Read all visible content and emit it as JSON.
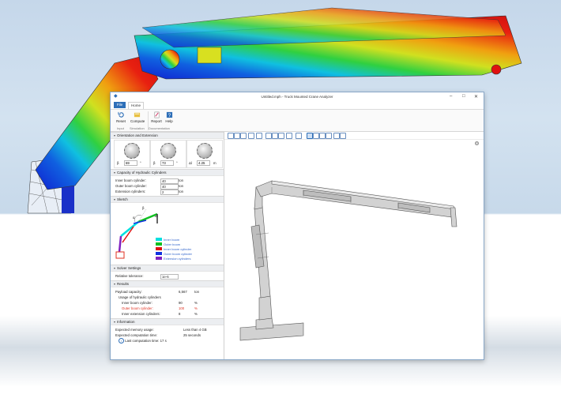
{
  "window": {
    "title": "Untitled.mph - Truck Mounted Crane Analyzer",
    "controls": [
      "–",
      "□",
      "✕"
    ]
  },
  "tabs": {
    "file": "File",
    "home": "Home"
  },
  "ribbon": {
    "reset": "Reset",
    "compute": "Compute",
    "report": "Report",
    "help": "Help",
    "groups": [
      "Input",
      "Simulation",
      "Documentation"
    ]
  },
  "orientation": {
    "header": "Orientation and Extension",
    "knobs": [
      {
        "sym": "β",
        "value": "69",
        "unit": "°"
      },
      {
        "sym": "β",
        "value": "73",
        "unit": "°"
      },
      {
        "sym": "Δl",
        "value": "4.25",
        "unit": "m"
      }
    ]
  },
  "capacity": {
    "header": "Capacity of Hydraulic Cylinders",
    "rows": [
      {
        "label": "Inner boom cylinder:",
        "value": "40",
        "unit": "ton"
      },
      {
        "label": "Outer boom cylinder:",
        "value": "40",
        "unit": "ton"
      },
      {
        "label": "Extension cylinders:",
        "value": "2",
        "unit": "ton"
      }
    ]
  },
  "sketch": {
    "header": "Sketch",
    "legend": [
      {
        "label": "Inner boom",
        "color": "#00e0e0"
      },
      {
        "label": "Outer boom",
        "color": "#10c020"
      },
      {
        "label": "Inner boom cylinder",
        "color": "#e01010"
      },
      {
        "label": "Outer boom cylinder",
        "color": "#1030e0"
      },
      {
        "label": "Extension cylinders",
        "color": "#8020c0"
      }
    ],
    "labels": {
      "beta": "β",
      "alpha": "α",
      "dl": "Δl"
    }
  },
  "solver": {
    "header": "Solver Settings",
    "label": "Relative tolerance:",
    "value": "1e-6"
  },
  "results": {
    "header": "Results",
    "payload_label": "Payload capacity:",
    "payload_value": "6,567",
    "payload_unit": "ton",
    "usage_label": "Usage of hydraulic cylinders",
    "rows": [
      {
        "label": "Inner boom cylinder:",
        "value": "90",
        "unit": "%",
        "color": "#222222"
      },
      {
        "label": "Outer boom cylinder:",
        "value": "100",
        "unit": "%",
        "color": "#e03020"
      },
      {
        "label": "Inner extension cylinders:",
        "value": "8",
        "unit": "%",
        "color": "#222222"
      }
    ]
  },
  "information": {
    "header": "Information",
    "rows": [
      {
        "label": "Expected memory usage:",
        "value": "Less than 4 GB"
      },
      {
        "label": "Expected computation time:",
        "value": "25 seconds"
      }
    ],
    "last": "Last computation time: 17 s"
  },
  "colors": {
    "accent": "#2e6fb8",
    "panel_header": "#eceef1"
  }
}
